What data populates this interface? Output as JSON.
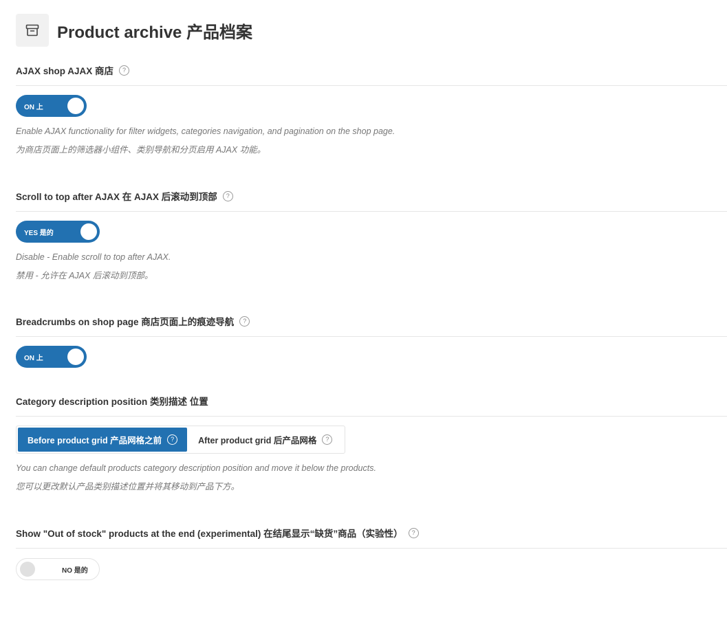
{
  "header": {
    "title": "Product archive  产品档案",
    "icon": "archive-icon"
  },
  "help_glyph": "?",
  "colors": {
    "accent": "#2271b1",
    "toggle_off_knob": "#e0e0e0"
  },
  "settings": {
    "ajax_shop": {
      "label": "AJAX shop  AJAX 商店",
      "toggle": "ON  上",
      "state": "on",
      "desc_en": "Enable AJAX functionality for filter widgets, categories navigation, and pagination on the shop page.",
      "desc_zh": "为商店页面上的筛选器小组件、类别导航和分页启用 AJAX 功能。"
    },
    "scroll_top": {
      "label": "Scroll to top after AJAX  在 AJAX 后滚动到顶部",
      "toggle": "YES  是的",
      "state": "on",
      "desc_en": "Disable - Enable scroll to top after AJAX.",
      "desc_zh": "禁用 - 允许在 AJAX 后滚动到顶部。"
    },
    "breadcrumbs": {
      "label": "Breadcrumbs on shop page  商店页面上的痕迹导航",
      "toggle": "ON  上",
      "state": "on"
    },
    "category_desc": {
      "label": "Category description position  类别描述 位置",
      "options": [
        {
          "label": "Before product grid  产品网格之前",
          "selected": true
        },
        {
          "label": "After product grid  后产品网格",
          "selected": false
        }
      ],
      "desc_en": "You can change default products category description position and move it below the products.",
      "desc_zh": "您可以更改默认产品类别描述位置并将其移动到产品下方。"
    },
    "out_of_stock": {
      "label": "Show \"Out of stock\" products at the end (experimental)  在结尾显示“缺货”商品（实验性）",
      "toggle": "NO  是的",
      "state": "off"
    }
  }
}
